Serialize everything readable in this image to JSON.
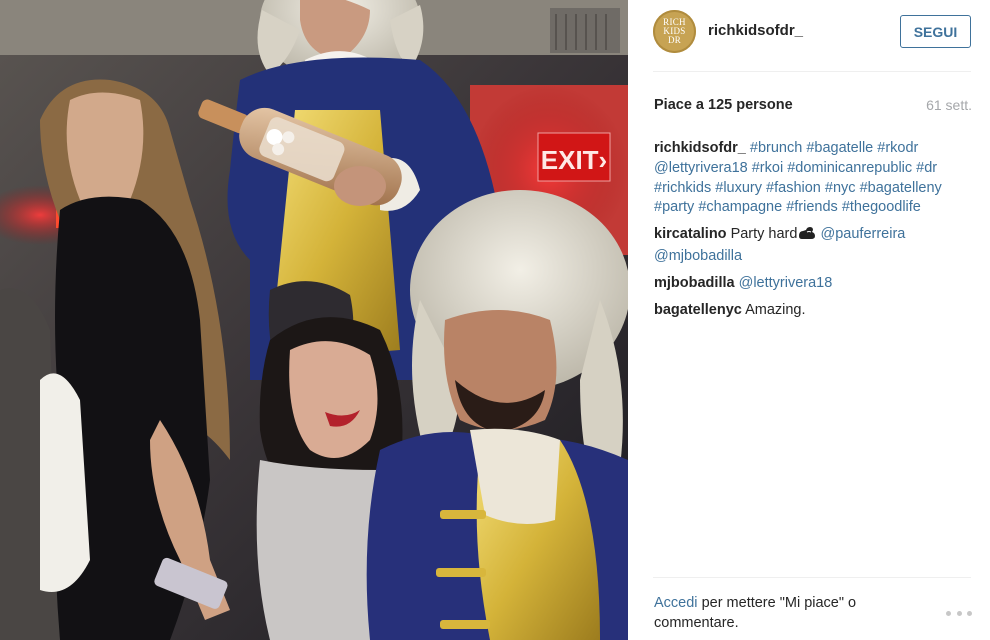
{
  "post": {
    "photo_icon": "party-photo",
    "account": {
      "username": "richkidsofdr_",
      "avatar_text": "RICH KIDS DR",
      "avatar_icon": "gold-circle-logo"
    },
    "follow_label": "SEGUI",
    "likes_text": "Piace a 125 persone",
    "time_text": "61 sett.",
    "caption": {
      "user": "richkidsofdr_",
      "tags": [
        "#brunch",
        "#bagatelle",
        "#rkodr",
        "@lettyrivera18",
        "#rkoi",
        "#dominicanrepublic",
        "#dr",
        "#richkids",
        "#luxury",
        "#fashion",
        "#nyc",
        "#bagatelleny",
        "#party",
        "#champagne",
        "#friends",
        "#thegoodlife"
      ]
    },
    "comments": [
      {
        "user": "kircatalino",
        "text": "Party hard",
        "emoji": "flexed-biceps-icon",
        "mentions": [
          "@pauferreira",
          "@mjbobadilla"
        ]
      },
      {
        "user": "mjbobadilla",
        "text": "",
        "mentions": [
          "@lettyrivera18"
        ]
      },
      {
        "user": "bagatellenyc",
        "text": "Amazing."
      }
    ],
    "footer": {
      "login_link": "Accedi",
      "text": "per mettere \"Mi piace\" o commentare."
    },
    "more_icon": "ellipsis-icon",
    "colors": {
      "link": "#3f729b",
      "text": "#262626",
      "muted": "#a5a7aa",
      "avatar_gold": "#c7a353"
    }
  }
}
